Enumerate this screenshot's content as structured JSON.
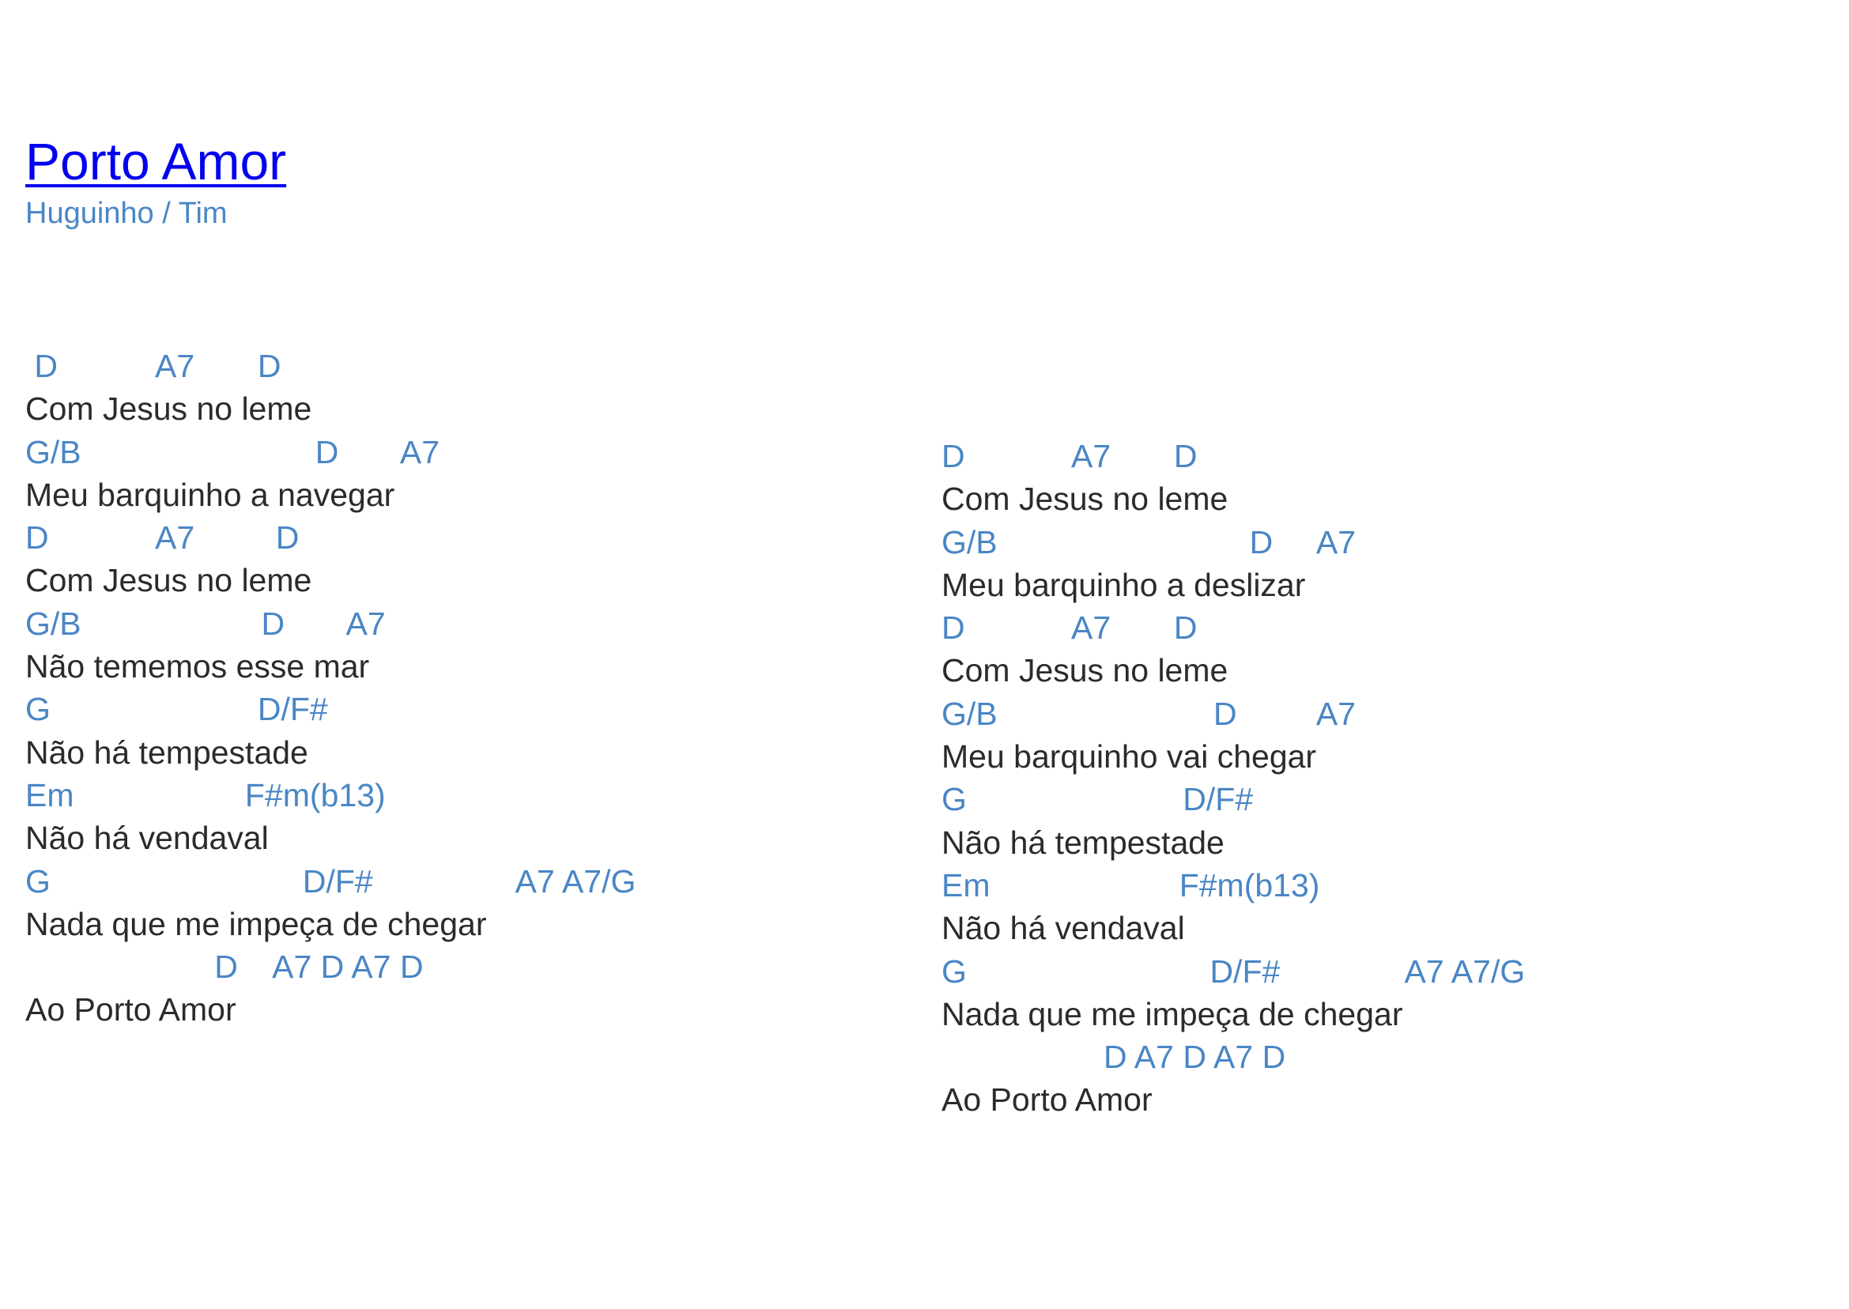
{
  "song": {
    "title": "Porto Amor",
    "authors": "Huguinho / Tim"
  },
  "colors": {
    "title": "#0000ee",
    "chords": "#4a86c5",
    "lyrics": "#2b2b2b"
  },
  "columns": [
    {
      "lines": [
        {
          "type": "chord",
          "text": " D           A7       D"
        },
        {
          "type": "lyric",
          "text": "Com Jesus no leme"
        },
        {
          "type": "chord",
          "text": "G/B                          D       A7"
        },
        {
          "type": "lyric",
          "text": "Meu barquinho a navegar"
        },
        {
          "type": "chord",
          "text": "D            A7         D"
        },
        {
          "type": "lyric",
          "text": "Com Jesus no leme"
        },
        {
          "type": "chord",
          "text": "G/B                    D       A7"
        },
        {
          "type": "lyric",
          "text": "Não tememos esse mar"
        },
        {
          "type": "chord",
          "text": "G                       D/F#"
        },
        {
          "type": "lyric",
          "text": "Não há tempestade"
        },
        {
          "type": "chord",
          "text": "Em                   F#m(b13)"
        },
        {
          "type": "lyric",
          "text": "Não há vendaval"
        },
        {
          "type": "chord",
          "text": "G                            D/F#                A7 A7/G"
        },
        {
          "type": "lyric",
          "text": "Nada que me impeça de chegar"
        },
        {
          "type": "chord",
          "text": "                     D    A7 D A7 D"
        },
        {
          "type": "lyric",
          "text": "Ao Porto Amor"
        }
      ]
    },
    {
      "lines": [
        {
          "type": "chord",
          "text": "D            A7       D"
        },
        {
          "type": "lyric",
          "text": "Com Jesus no leme"
        },
        {
          "type": "chord",
          "text": "G/B                            D     A7"
        },
        {
          "type": "lyric",
          "text": "Meu barquinho a deslizar"
        },
        {
          "type": "chord",
          "text": "D            A7       D"
        },
        {
          "type": "lyric",
          "text": "Com Jesus no leme"
        },
        {
          "type": "chord",
          "text": "G/B                        D         A7"
        },
        {
          "type": "lyric",
          "text": "Meu barquinho vai chegar"
        },
        {
          "type": "chord",
          "text": "G                        D/F#"
        },
        {
          "type": "lyric",
          "text": "Não há tempestade"
        },
        {
          "type": "chord",
          "text": "Em                     F#m(b13)"
        },
        {
          "type": "lyric",
          "text": "Não há vendaval"
        },
        {
          "type": "chord",
          "text": "G                           D/F#              A7 A7/G"
        },
        {
          "type": "lyric",
          "text": "Nada que me impeça de chegar"
        },
        {
          "type": "chord",
          "text": "                  D A7 D A7 D"
        },
        {
          "type": "lyric",
          "text": "Ao Porto Amor"
        }
      ]
    }
  ]
}
